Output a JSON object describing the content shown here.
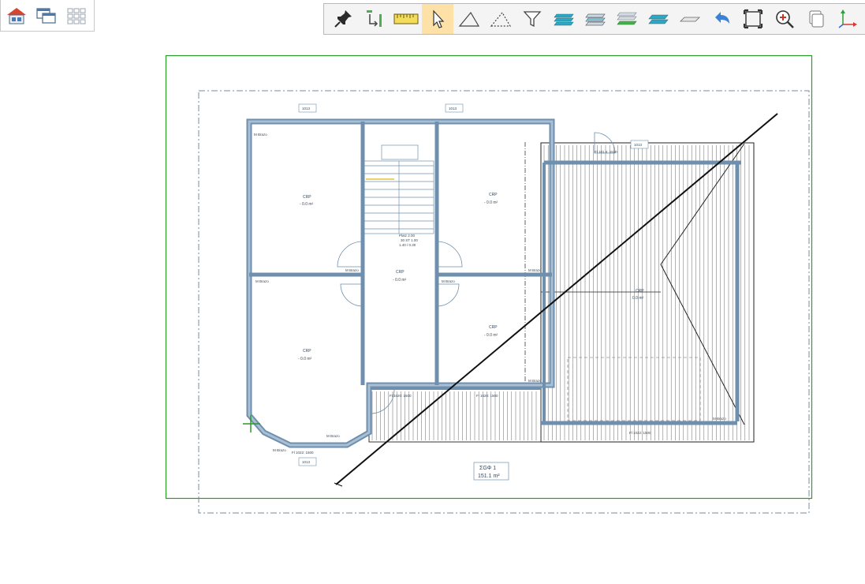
{
  "toolbar_left": {
    "buttons": [
      {
        "name": "house-icon"
      },
      {
        "name": "windows-icon"
      },
      {
        "name": "grid-icon"
      }
    ]
  },
  "toolbar_main": {
    "buttons": [
      {
        "name": "pin-icon"
      },
      {
        "name": "transform-icon"
      },
      {
        "name": "ruler-icon"
      },
      {
        "name": "cursor-icon",
        "active": true
      },
      {
        "name": "triangle-icon"
      },
      {
        "name": "dashed-triangle-icon"
      },
      {
        "name": "filter-icon"
      },
      {
        "name": "layers-blue-icon"
      },
      {
        "name": "layers-gray-icon"
      },
      {
        "name": "layers-green-icon"
      },
      {
        "name": "layer-plane-icon"
      },
      {
        "name": "plane-icon"
      },
      {
        "name": "undo-arrow-icon"
      },
      {
        "name": "fit-frame-icon"
      },
      {
        "name": "zoom-in-icon"
      },
      {
        "name": "copy-icon"
      },
      {
        "name": "axes-icon"
      }
    ]
  },
  "plan": {
    "rooms": [
      {
        "id": "room-top-left",
        "name": "CRP",
        "area": "- 0.0 m²"
      },
      {
        "id": "room-top-right",
        "name": "CRP",
        "area": "- 0.0 m²"
      },
      {
        "id": "room-center",
        "name": "CRP",
        "area": "- 0.0 m²"
      },
      {
        "id": "room-bottom-left",
        "name": "CRP",
        "area": "- 0.0 m²"
      },
      {
        "id": "room-bottom-right",
        "name": "CRP",
        "area": "- 0.0 m²"
      },
      {
        "id": "room-roof",
        "name": "CRP",
        "area": "0.0 m²"
      }
    ],
    "total_area": {
      "title": "ΣGΦ 1",
      "value": "151.1 m²"
    },
    "wall_labels": [
      "M Brazo",
      "M Brazo",
      "M Brazo",
      "M Brazo",
      "M Brazo",
      "M Brazo",
      "M Brazo",
      "M Brazo",
      "M Brazo"
    ],
    "dimension_labels": [
      "1013",
      "1013",
      "1013",
      "1013"
    ],
    "opening_labels": [
      "Fl 101.5: 1530",
      "Fl 1022: 1500",
      "Fl 1022: 1500",
      "Fl 1020: 1500",
      "Fl 1020: 1500"
    ],
    "stair_label": {
      "line1": "Platz 2.00",
      "line2": "30 ST 1.00",
      "line3": "1.40 / 0.30"
    },
    "colors": {
      "frame": "#2a9a2a",
      "wall": "#6f8fae",
      "wall_light": "#a9bfd4",
      "cut_line": "#111111",
      "dashdot": "#7a8a9a"
    }
  }
}
